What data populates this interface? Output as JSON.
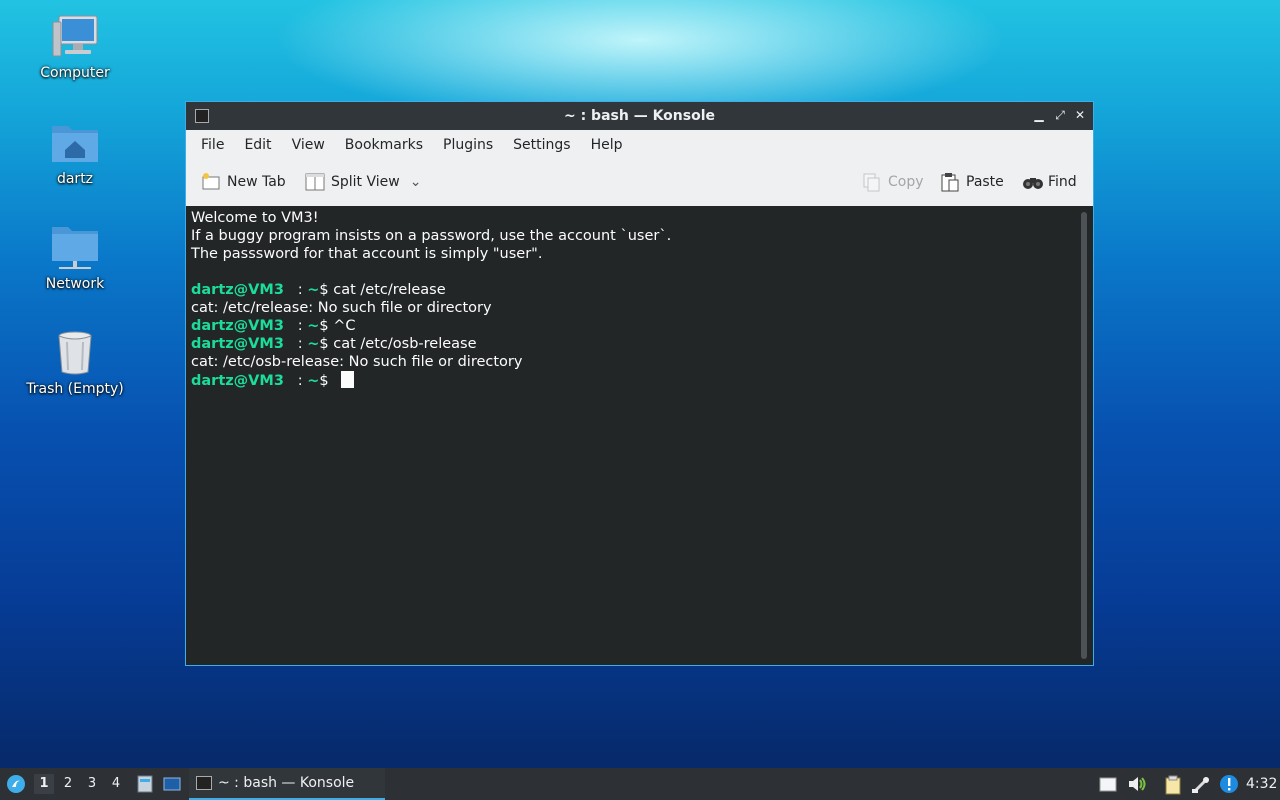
{
  "desktop": {
    "icons": [
      {
        "label": "Computer"
      },
      {
        "label": "dartz"
      },
      {
        "label": "Network"
      },
      {
        "label": "Trash (Empty)"
      }
    ]
  },
  "window": {
    "title": "~ : bash — Konsole",
    "menu": [
      "File",
      "Edit",
      "View",
      "Bookmarks",
      "Plugins",
      "Settings",
      "Help"
    ],
    "toolbar": {
      "new_tab": "New Tab",
      "split_view": "Split View",
      "copy": "Copy",
      "paste": "Paste",
      "find": "Find"
    },
    "terminal": {
      "motd": [
        "Welcome to VM3!",
        "If a buggy program insists on a password, use the account `user`.",
        "The passsword for that account is simply \"user\"."
      ],
      "prompt_user": "dartz@VM3",
      "prompt_sep": "   : ",
      "prompt_dir": "~",
      "prompt_sym": "$ ",
      "commands": [
        {
          "cmd": "cat /etc/release",
          "output": "cat: /etc/release: No such file or directory"
        },
        {
          "cmd": "^C",
          "output": ""
        },
        {
          "cmd": "cat /etc/osb-release",
          "output": "cat: /etc/osb-release: No such file or directory"
        }
      ]
    }
  },
  "taskbar": {
    "workspaces": [
      "1",
      "2",
      "3",
      "4"
    ],
    "active_workspace": "1",
    "task_label": "~ : bash — Konsole",
    "clock": "4:32"
  },
  "colors": {
    "accent": "#3daee9",
    "prompt": "#1cdc9a",
    "terminal_bg": "#232627"
  }
}
